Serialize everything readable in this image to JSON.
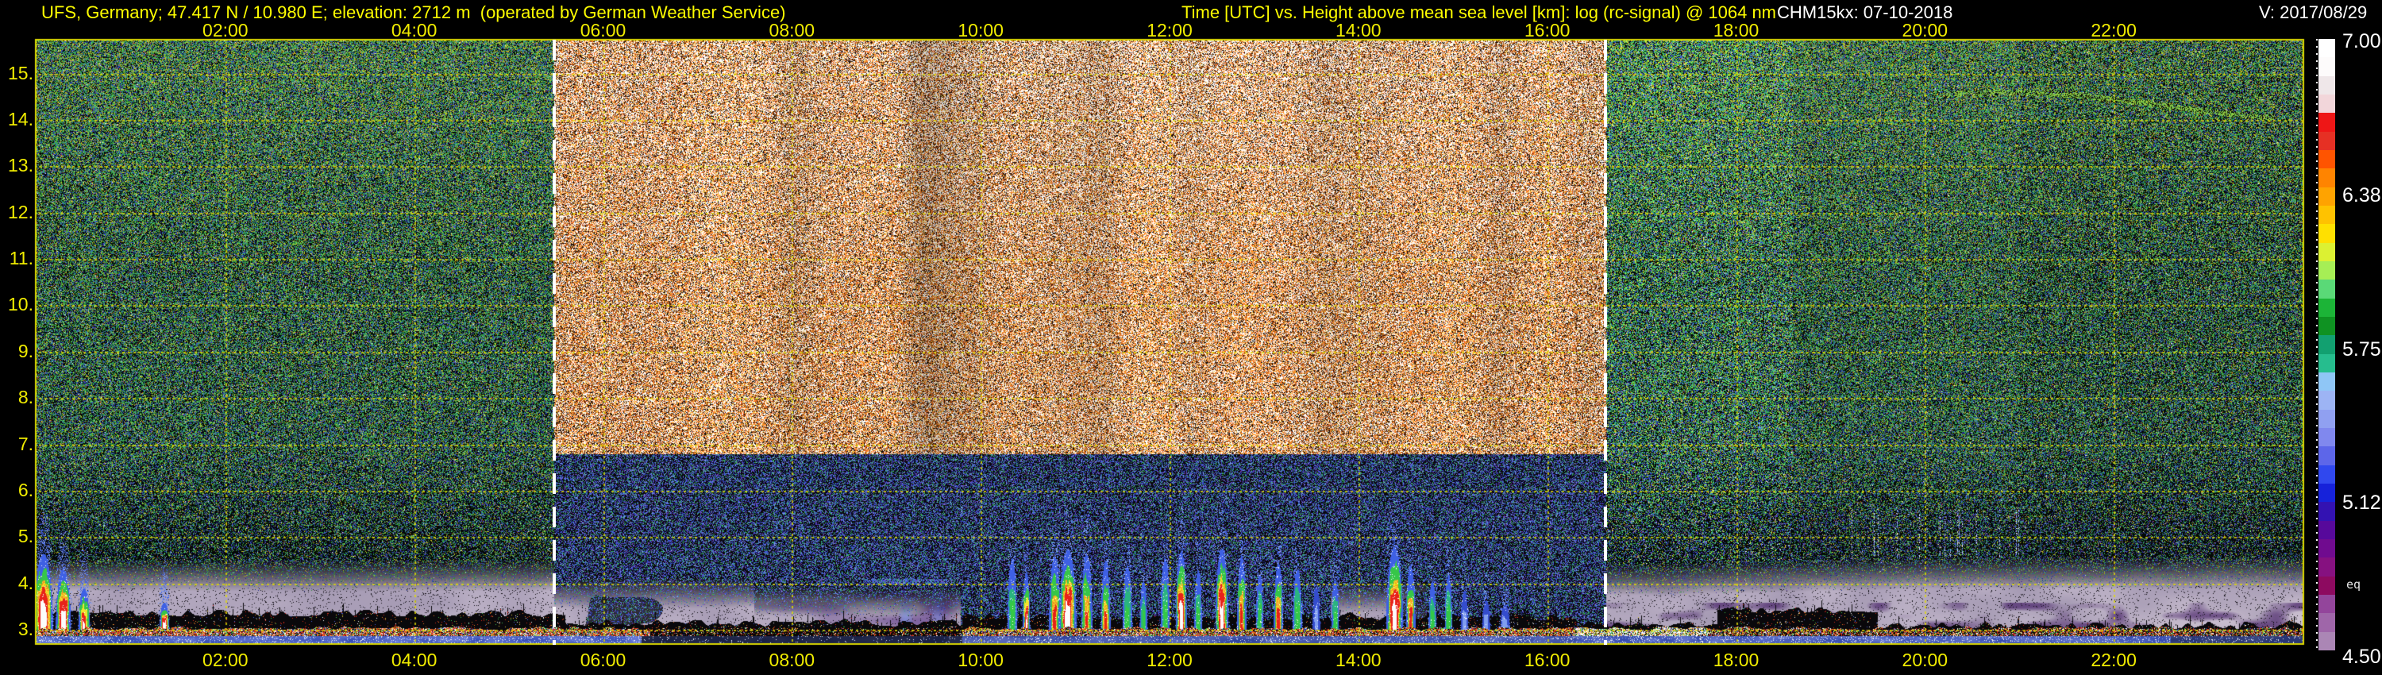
{
  "header": {
    "station": "UFS, Germany; 47.417 N / 10.980 E; elevation: 2712 m  (operated by German Weather Service)",
    "title": "Time [UTC] vs. Height above mean sea level [km]: log (rc-signal) @ 1064 nm",
    "instrument": "CHM15kx: 07-10-2018",
    "version": "V: 2017/08/29"
  },
  "colors": {
    "background": "#000000",
    "axis_text_yellow": "#f0ec00",
    "header_yellow": "#fdfd00",
    "grid_yellow": "#e2dc00",
    "border_yellow": "#dcd800",
    "marker_white": "#ffffff",
    "text_white": "#ffffff"
  },
  "axes": {
    "x_tick_labels": [
      "02:00",
      "04:00",
      "06:00",
      "08:00",
      "10:00",
      "12:00",
      "14:00",
      "16:00",
      "18:00",
      "20:00",
      "22:00"
    ],
    "x_tick_hours": [
      2,
      4,
      6,
      8,
      10,
      12,
      14,
      16,
      18,
      20,
      22
    ],
    "y_tick_labels": [
      "15.",
      "14.",
      "13.",
      "12.",
      "11.",
      "10.",
      "9.",
      "8.",
      "7.",
      "6.",
      "5.",
      "4.",
      "3."
    ],
    "y_tick_km": [
      15,
      14,
      13,
      12,
      11,
      10,
      9,
      8,
      7,
      6,
      5,
      4,
      3
    ],
    "colorbar_tick_labels": [
      "7.00",
      "6.38",
      "5.75",
      "5.12",
      "4.50"
    ],
    "colorbar_note": "eq"
  },
  "chart_data": {
    "type": "heatmap",
    "title": "Time [UTC] vs. Height above mean sea level [km]: log (rc-signal) @ 1064 nm",
    "x_axis": {
      "label": "Time [UTC]",
      "range_hours": [
        0,
        24
      ],
      "tick_step": 2
    },
    "y_axis": {
      "label": "Height above mean sea level [km]",
      "range_km": [
        2.712,
        15.712
      ],
      "tick_step": 1
    },
    "z_axis": {
      "label": "log (rc-signal) @ 1064 nm",
      "range": [
        4.5,
        7.0
      ],
      "tick_values": [
        7.0,
        6.38,
        5.75,
        5.12,
        4.5
      ]
    },
    "colorbar_palette": [
      "#ffffff",
      "#fdfbfb",
      "#efe7e9",
      "#f2d6da",
      "#ee1616",
      "#e63024",
      "#ff5400",
      "#ff8400",
      "#ffa300",
      "#ffc200",
      "#ffe000",
      "#dcf132",
      "#a6ee55",
      "#5ad977",
      "#1cb437",
      "#0f9222",
      "#12a070",
      "#26bd8e",
      "#8fc6f6",
      "#9db4f4",
      "#90a0f1",
      "#8088ee",
      "#5d66e9",
      "#3048ee",
      "#1622da",
      "#3312b2",
      "#57099b",
      "#700b8f",
      "#861180",
      "#8d0a60",
      "#93459b",
      "#9f66a9",
      "#ab86b5"
    ],
    "markers": {
      "style": "white-dashed-vertical",
      "times_utc": [
        5.48,
        16.62
      ]
    },
    "features": {
      "daytime_solar_noise_utc": [
        5.48,
        16.62
      ],
      "haze_segments": [
        [
          0,
          5.48,
          4.42,
          0
        ],
        [
          5.48,
          7.6,
          4.05,
          1
        ],
        [
          7.6,
          9.78,
          3.88,
          2
        ],
        [
          13.7,
          14.72,
          3.95,
          1
        ],
        [
          16.62,
          24,
          4.32,
          3
        ]
      ],
      "terrain_segments": [
        [
          0,
          5.6,
          3.36
        ],
        [
          5.6,
          9.8,
          3.16
        ],
        [
          9.8,
          16.3,
          3.3
        ],
        [
          16.3,
          17.8,
          3.14
        ],
        [
          17.8,
          19.5,
          3.44
        ],
        [
          19.5,
          24,
          3.1
        ]
      ],
      "surface_sparkle_segments": [
        [
          0,
          6.5,
          1.0
        ],
        [
          6.5,
          9.8,
          0.3
        ],
        [
          9.8,
          16.3,
          0.95
        ],
        [
          16.3,
          17.7,
          1.15
        ],
        [
          17.7,
          24,
          0.75
        ]
      ],
      "bottom_blue_segments": [
        [
          0,
          6.4,
          1.0
        ],
        [
          6.4,
          9.8,
          0.25
        ],
        [
          9.8,
          16.3,
          0.85
        ],
        [
          16.3,
          22.6,
          0.95
        ],
        [
          22.6,
          24,
          0.55
        ]
      ],
      "cloud_plumes": [
        [
          0.07,
          4.65,
          0.1,
          "white"
        ],
        [
          0.28,
          4.3,
          0.08,
          "white"
        ],
        [
          0.5,
          3.9,
          0.06,
          "rainbow"
        ],
        [
          1.35,
          3.6,
          0.05,
          "white"
        ],
        [
          10.33,
          4.55,
          0.05,
          "green"
        ],
        [
          10.48,
          4.25,
          0.04,
          "rainbow"
        ],
        [
          10.78,
          4.6,
          0.06,
          "red"
        ],
        [
          10.92,
          4.75,
          0.09,
          "white"
        ],
        [
          11.12,
          4.65,
          0.06,
          "red"
        ],
        [
          11.32,
          4.5,
          0.05,
          "red"
        ],
        [
          11.55,
          4.4,
          0.05,
          "green"
        ],
        [
          11.72,
          4.05,
          0.04,
          "green"
        ],
        [
          11.95,
          4.55,
          0.05,
          "green"
        ],
        [
          12.12,
          4.7,
          0.06,
          "white"
        ],
        [
          12.3,
          4.3,
          0.04,
          "green"
        ],
        [
          12.55,
          4.75,
          0.07,
          "white"
        ],
        [
          12.76,
          4.6,
          0.05,
          "red"
        ],
        [
          12.95,
          4.2,
          0.04,
          "green"
        ],
        [
          13.15,
          4.45,
          0.05,
          "red"
        ],
        [
          13.35,
          4.3,
          0.05,
          "green"
        ],
        [
          13.55,
          3.95,
          0.04,
          "blue"
        ],
        [
          13.75,
          4.1,
          0.04,
          "green"
        ],
        [
          14.38,
          4.8,
          0.09,
          "white"
        ],
        [
          14.55,
          4.4,
          0.05,
          "red"
        ],
        [
          14.78,
          4.05,
          0.04,
          "green"
        ],
        [
          14.95,
          4.2,
          0.04,
          "green"
        ],
        [
          15.12,
          3.85,
          0.04,
          "blue"
        ],
        [
          15.35,
          3.65,
          0.04,
          "blue"
        ],
        [
          15.55,
          3.55,
          0.05,
          "blue"
        ]
      ],
      "green_trace": {
        "t_range": [
          20.2,
          23.7
        ],
        "height_km": 14.3
      }
    }
  }
}
